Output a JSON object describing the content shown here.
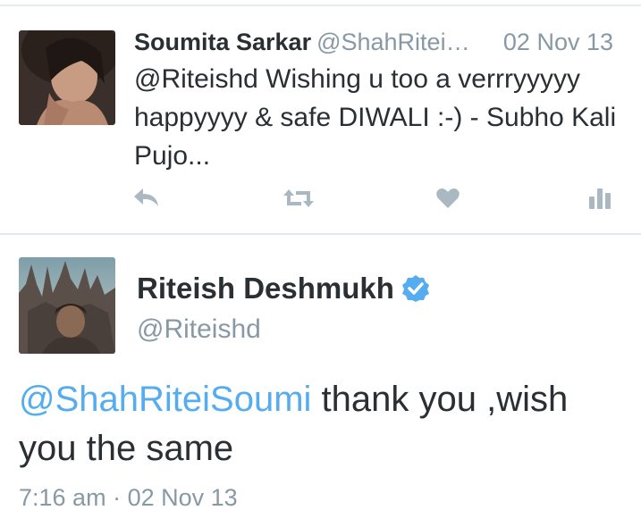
{
  "tweets": [
    {
      "author_name": "Soumita Sarkar",
      "handle": "@ShahRiteiS...",
      "date": "02 Nov 13",
      "text": "@Riteishd Wishing u too a verrryyyyy happyyyy & safe DIWALI :-) - Subho Kali Pujo...",
      "actions": [
        "reply-icon",
        "retweet-icon",
        "like-heart-icon",
        "analytics-icon"
      ]
    },
    {
      "author_name": "Riteish Deshmukh",
      "handle": "@Riteishd",
      "verified": true,
      "mention": "@ShahRiteiSoumi",
      "text_rest": " thank you ,wish you the same",
      "time": "7:16 am",
      "separator": "·",
      "date": "02 Nov 13"
    }
  ],
  "colors": {
    "link": "#55acee",
    "muted": "#8899a6",
    "text": "#292f33",
    "icon": "#aab8c2",
    "divider": "#e1e8ed"
  }
}
